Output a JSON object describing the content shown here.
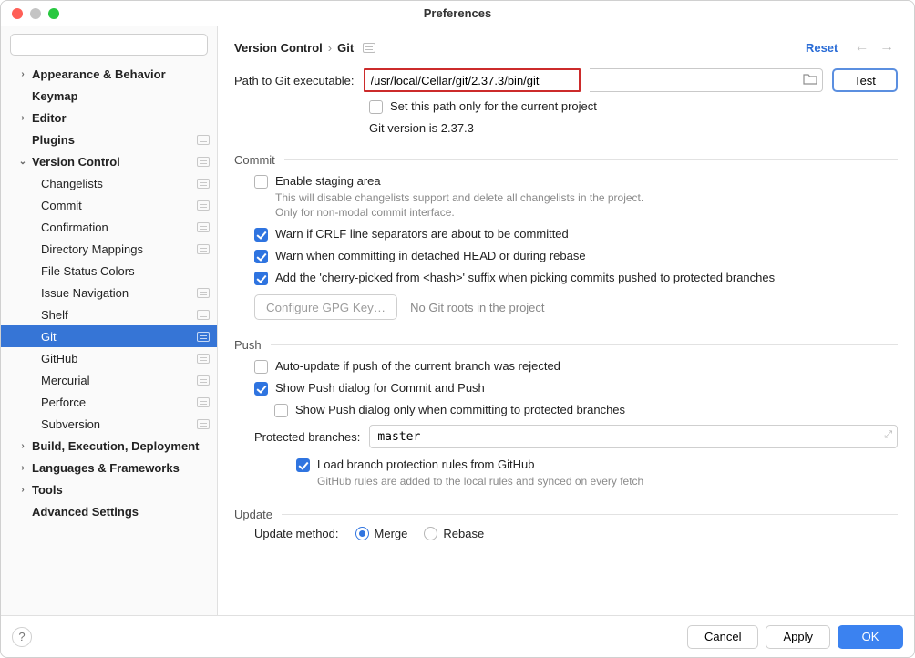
{
  "window": {
    "title": "Preferences"
  },
  "search": {
    "placeholder": ""
  },
  "sidebar": {
    "items": [
      {
        "label": "Appearance & Behavior",
        "top": true,
        "badge": false,
        "disclosure": "›"
      },
      {
        "label": "Keymap",
        "top": true,
        "badge": false,
        "disclosure": ""
      },
      {
        "label": "Editor",
        "top": true,
        "badge": false,
        "disclosure": "›"
      },
      {
        "label": "Plugins",
        "top": true,
        "badge": true,
        "disclosure": ""
      },
      {
        "label": "Version Control",
        "top": true,
        "badge": true,
        "disclosure": "⌄"
      },
      {
        "label": "Changelists",
        "top": false,
        "badge": true
      },
      {
        "label": "Commit",
        "top": false,
        "badge": true
      },
      {
        "label": "Confirmation",
        "top": false,
        "badge": true
      },
      {
        "label": "Directory Mappings",
        "top": false,
        "badge": true
      },
      {
        "label": "File Status Colors",
        "top": false,
        "badge": false
      },
      {
        "label": "Issue Navigation",
        "top": false,
        "badge": true
      },
      {
        "label": "Shelf",
        "top": false,
        "badge": true
      },
      {
        "label": "Git",
        "top": false,
        "badge": true,
        "selected": true
      },
      {
        "label": "GitHub",
        "top": false,
        "badge": true
      },
      {
        "label": "Mercurial",
        "top": false,
        "badge": true
      },
      {
        "label": "Perforce",
        "top": false,
        "badge": true
      },
      {
        "label": "Subversion",
        "top": false,
        "badge": true
      },
      {
        "label": "Build, Execution, Deployment",
        "top": true,
        "badge": false,
        "disclosure": "›"
      },
      {
        "label": "Languages & Frameworks",
        "top": true,
        "badge": false,
        "disclosure": "›"
      },
      {
        "label": "Tools",
        "top": true,
        "badge": false,
        "disclosure": "›"
      },
      {
        "label": "Advanced Settings",
        "top": true,
        "badge": false,
        "disclosure": ""
      }
    ]
  },
  "breadcrumb": {
    "parent": "Version Control",
    "current": "Git"
  },
  "reset_label": "Reset",
  "git_path": {
    "label": "Path to Git executable:",
    "value": "/usr/local/Cellar/git/2.37.3/bin/git",
    "test_label": "Test",
    "scope_checkbox": "Set this path only for the current project",
    "version_line": "Git version is 2.37.3"
  },
  "commit": {
    "title": "Commit",
    "enable_staging": "Enable staging area",
    "enable_staging_desc": "This will disable changelists support and delete all changelists in the project. Only for non-modal commit interface.",
    "warn_crlf": "Warn if CRLF line separators are about to be committed",
    "warn_detached": "Warn when committing in detached HEAD or during rebase",
    "cherry_suffix": "Add the 'cherry-picked from <hash>' suffix when picking commits pushed to protected branches",
    "gpg_button": "Configure GPG Key…",
    "no_roots": "No Git roots in the project"
  },
  "push": {
    "title": "Push",
    "auto_update": "Auto-update if push of the current branch was rejected",
    "show_push_dialog": "Show Push dialog for Commit and Push",
    "show_push_protected": "Show Push dialog only when committing to protected branches",
    "protected_label": "Protected branches:",
    "protected_value": "master",
    "load_github": "Load branch protection rules from GitHub",
    "load_github_desc": "GitHub rules are added to the local rules and synced on every fetch"
  },
  "update": {
    "title": "Update",
    "method_label": "Update method:",
    "merge": "Merge",
    "rebase": "Rebase"
  },
  "footer": {
    "cancel": "Cancel",
    "apply": "Apply",
    "ok": "OK"
  }
}
